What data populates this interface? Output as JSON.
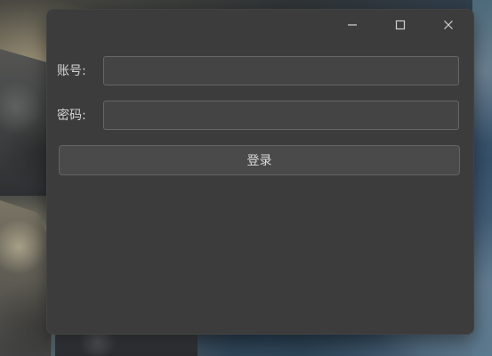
{
  "window": {
    "labels": {
      "account": "账号:",
      "password": "密码:"
    },
    "fields": {
      "account_value": "",
      "password_value": ""
    },
    "actions": {
      "login": "登录"
    },
    "icons": {
      "minimize": "minimize-icon",
      "maximize": "maximize-icon",
      "close": "close-icon"
    }
  },
  "colors": {
    "window_bg": "#3c3c3c",
    "field_bg": "#444444",
    "field_border": "#666666",
    "button_bg": "#4a4a4a",
    "text": "#d4d4d4"
  }
}
